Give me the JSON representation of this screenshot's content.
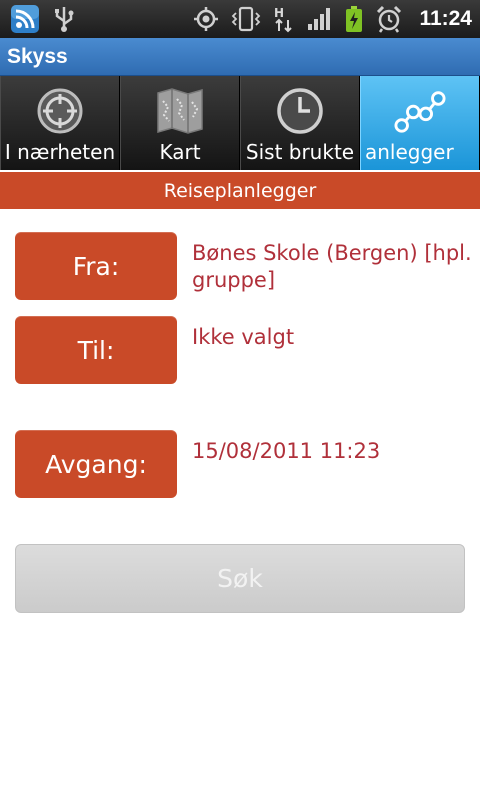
{
  "status_bar": {
    "time": "11:24",
    "icons": [
      "rss-notification-icon",
      "usb-icon",
      "gps-icon",
      "vibrate-icon",
      "hsdpa-data-icon",
      "signal-icon",
      "battery-charging-icon",
      "alarm-icon"
    ],
    "data_label": "H"
  },
  "app": {
    "title": "Skyss"
  },
  "tabs": [
    {
      "label": "I nærheten",
      "icon": "target-icon",
      "active": false
    },
    {
      "label": "Kart",
      "icon": "map-icon",
      "active": false
    },
    {
      "label": "Sist brukte",
      "icon": "clock-icon",
      "active": false
    },
    {
      "label": "anlegger",
      "icon": "route-icon",
      "active": true
    }
  ],
  "section": {
    "title": "Reiseplanlegger"
  },
  "form": {
    "from_label": "Fra:",
    "from_value": "Bønes Skole (Bergen) [hpl. gruppe]",
    "to_label": "Til:",
    "to_value": "Ikke valgt",
    "departure_label": "Avgang:",
    "departure_value": "15/08/2011 11:23",
    "search_label": "Søk"
  },
  "colors": {
    "accent": "#c94a28",
    "value_text": "#b0303a",
    "title_bar": "#3a7cc4",
    "active_tab": "#2ea8e8"
  }
}
